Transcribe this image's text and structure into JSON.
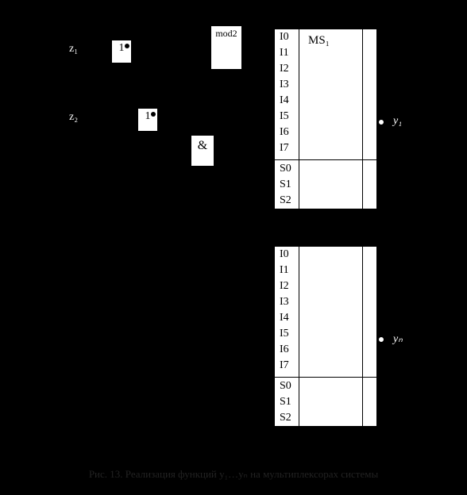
{
  "inputs_left": {
    "z1": "z₁",
    "z2": "z₂"
  },
  "gates": {
    "inv_label": "1",
    "mod2_label": "mod2",
    "and_label": "&"
  },
  "mux1": {
    "name_html": "MS₁",
    "data_inputs": [
      "I0",
      "I1",
      "I2",
      "I3",
      "I4",
      "I5",
      "I6",
      "I7"
    ],
    "select_inputs": [
      "S0",
      "S1",
      "S2"
    ],
    "output": "y₁"
  },
  "mux_n": {
    "name_html": "",
    "data_inputs": [
      "I0",
      "I1",
      "I2",
      "I3",
      "I4",
      "I5",
      "I6",
      "I7"
    ],
    "select_inputs": [
      "S0",
      "S1",
      "S2"
    ],
    "output": "yₙ"
  },
  "caption": "Рис. 13. Реализация функций y₁…yₙ на мультиплексорах системы"
}
